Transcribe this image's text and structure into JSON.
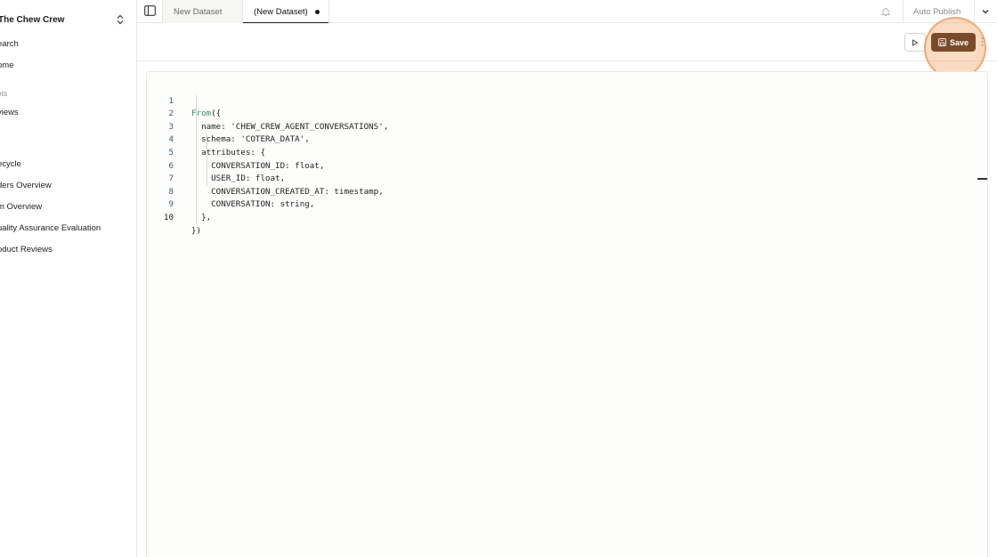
{
  "sidebar": {
    "team_name": "The Chew Crew",
    "items_top": [
      "earch",
      "ome"
    ],
    "section_label": "ets",
    "items_section": [
      "views"
    ],
    "items_lower": [
      "ecycle",
      "ders Overview",
      "m Overview",
      "uality Assurance Evaluation",
      "oduct Reviews"
    ]
  },
  "tabs": [
    {
      "label": "New Dataset",
      "active": false
    },
    {
      "label": "(New Dataset)",
      "active": true,
      "unsaved": true
    }
  ],
  "topbar": {
    "auto_publish_label": "Auto Publish"
  },
  "toolbar": {
    "save_label": "Save"
  },
  "editor": {
    "line_numbers": [
      "1",
      "2",
      "3",
      "4",
      "5",
      "6",
      "7",
      "8",
      "9",
      "10"
    ],
    "keyword": "From",
    "lines": [
      "({",
      "  name: 'CHEW_CREW_AGENT_CONVERSATIONS',",
      "  schema: 'COTERA_DATA',",
      "  attributes: {",
      "    CONVERSATION_ID: float,",
      "    USER_ID: float,",
      "    CONVERSATION_CREATED_AT: timestamp,",
      "    CONVERSATION: string,",
      "  },",
      "})"
    ]
  },
  "colors": {
    "save_button": "#7a4b2a",
    "highlight": "#f4aa6e",
    "keyword": "#2f8f62",
    "line_number": "#3a5a8a"
  },
  "icons": [
    "chevron-updown-icon",
    "panel-toggle-icon",
    "bell-icon",
    "chevron-down-icon",
    "play-icon",
    "save-icon",
    "more-dots-icon"
  ]
}
